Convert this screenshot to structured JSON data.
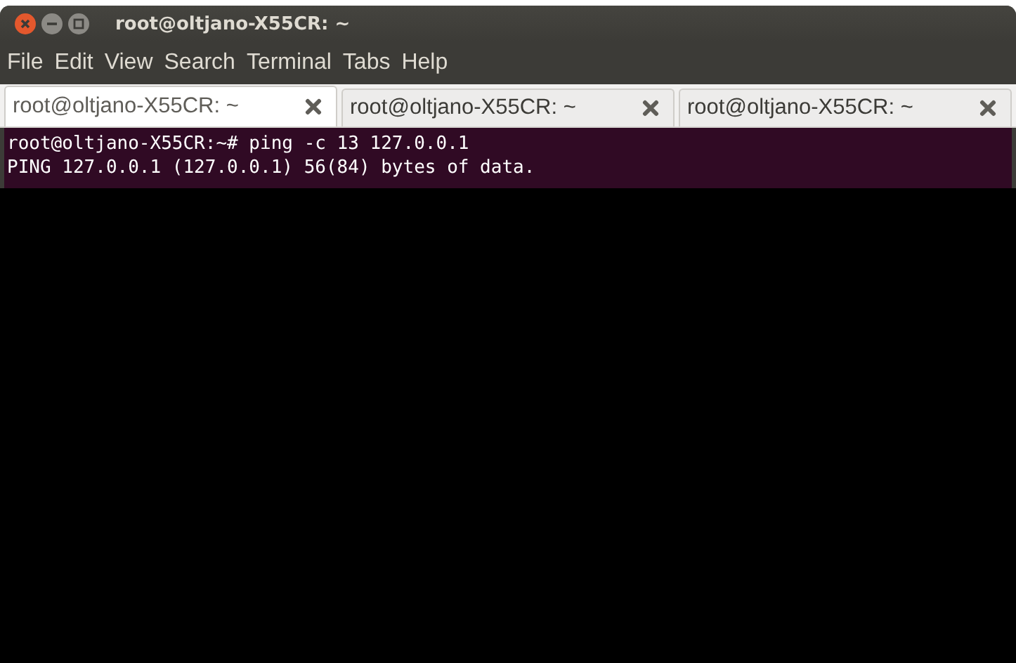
{
  "window": {
    "title": "root@oltjano-X55CR: ~"
  },
  "menu": [
    "File",
    "Edit",
    "View",
    "Search",
    "Terminal",
    "Tabs",
    "Help"
  ],
  "tabs": [
    {
      "label": "root@oltjano-X55CR: ~",
      "selected": true
    },
    {
      "label": "root@oltjano-X55CR: ~",
      "selected": false
    },
    {
      "label": "root@oltjano-X55CR: ~",
      "selected": false
    }
  ],
  "terminal": {
    "lines": [
      "root@oltjano-X55CR:~# ping -c 13 127.0.0.1",
      "PING 127.0.0.1 (127.0.0.1) 56(84) bytes of data."
    ]
  }
}
